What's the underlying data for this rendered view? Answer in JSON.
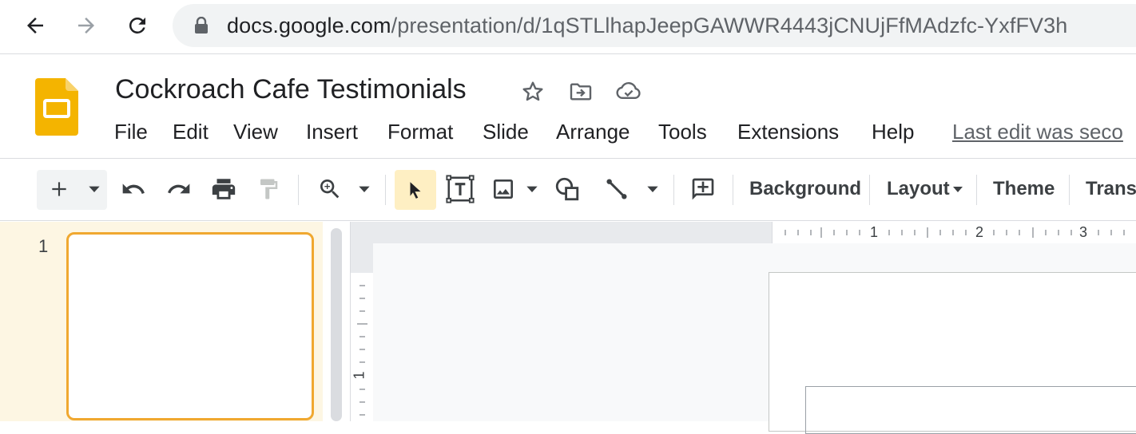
{
  "browser": {
    "url_host": "docs.google.com",
    "url_path": "/presentation/d/1qSTLlhapJeepGAWWR4443jCNUjFfMAdzfc-YxfFV3h"
  },
  "document": {
    "title": "Cockroach Cafe Testimonials"
  },
  "menu": {
    "items": [
      "File",
      "Edit",
      "View",
      "Insert",
      "Format",
      "Slide",
      "Arrange",
      "Tools",
      "Extensions",
      "Help"
    ],
    "last_edit": "Last edit was seco"
  },
  "toolbar": {
    "background_label": "Background",
    "layout_label": "Layout",
    "theme_label": "Theme",
    "transition_label": "Transi"
  },
  "filmstrip": {
    "slide_number": "1"
  },
  "ruler": {
    "labels": [
      "1",
      "2",
      "3"
    ],
    "left_label": "1"
  },
  "colors": {
    "slides_yellow": "#f4b400",
    "selection_highlight": "#feefc3",
    "thumb_border": "#f0a830"
  }
}
